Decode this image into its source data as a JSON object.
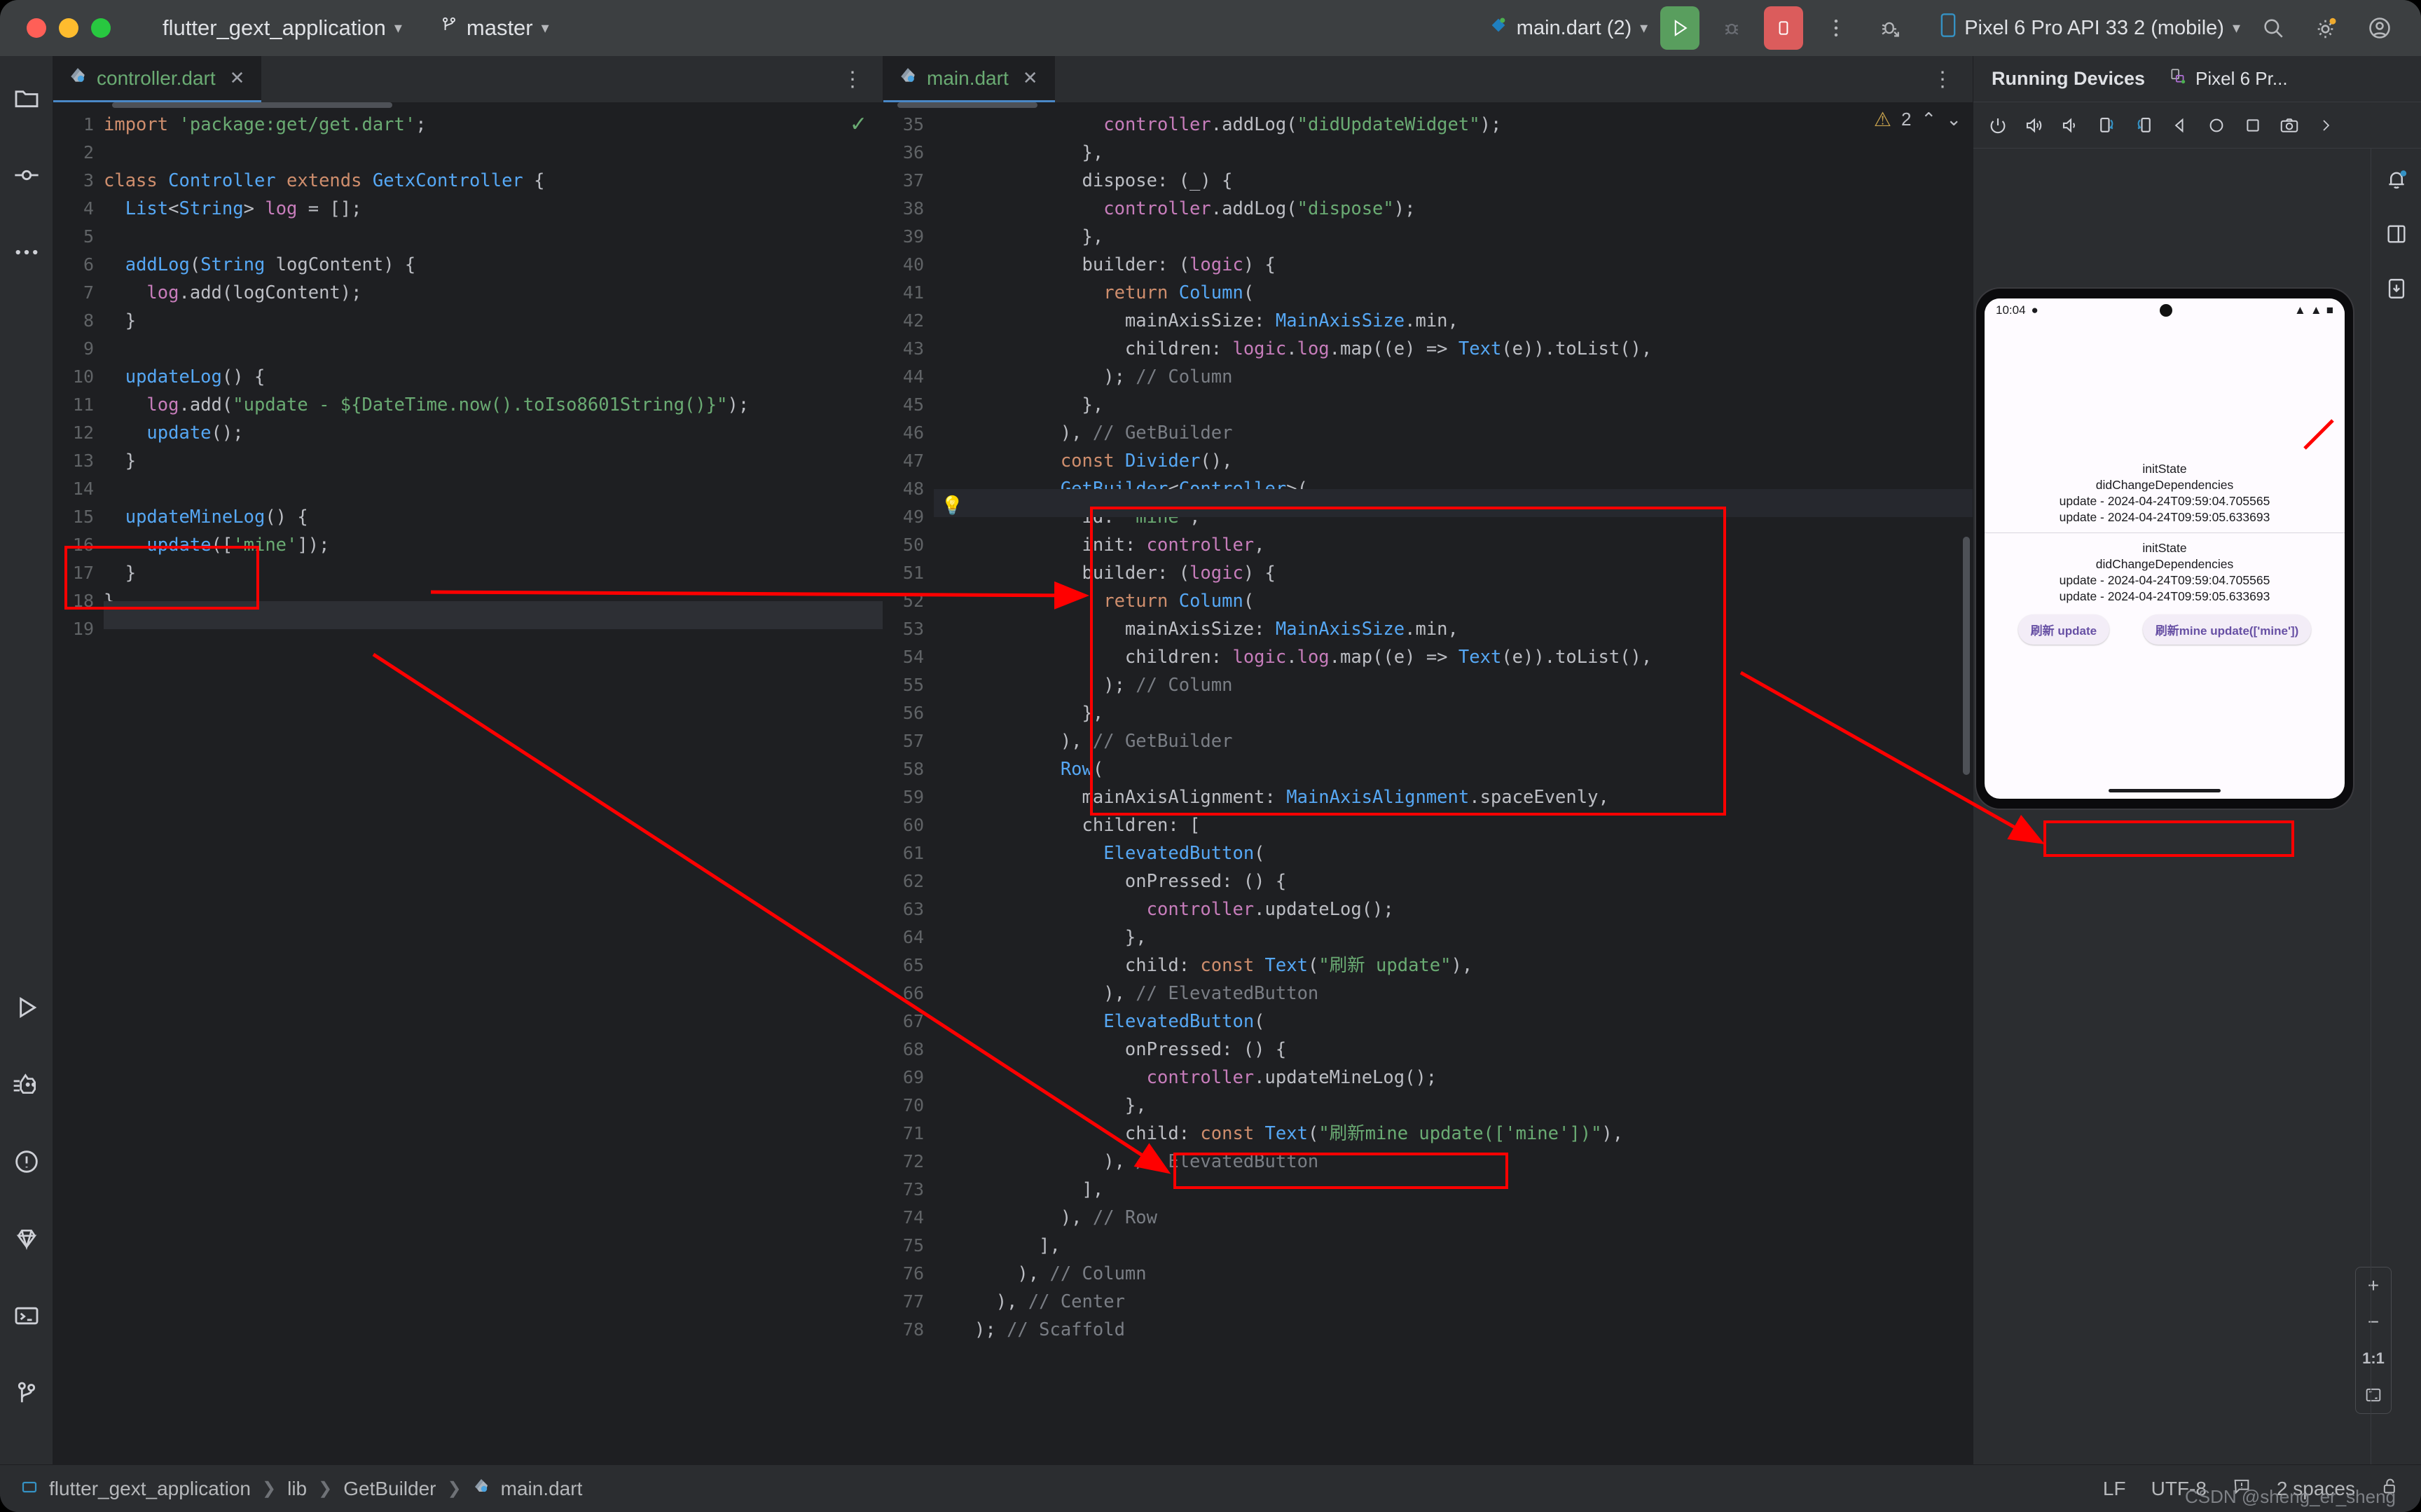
{
  "titlebar": {
    "project_name": "flutter_gext_application",
    "branch": "master",
    "run_config": "main.dart (2)",
    "device": "Pixel 6 Pro API 33 2 (mobile)",
    "icons": {
      "branch": "git-branch-icon",
      "run": "run-icon",
      "debug": "debug-icon",
      "stop": "stop-icon",
      "more": "more-vertical-icon",
      "profile": "profile-debug-icon",
      "search": "search-icon",
      "settings": "gear-icon",
      "account": "account-icon"
    }
  },
  "left_rail": {
    "top": [
      "project-icon",
      "commit-icon",
      "more-icon"
    ],
    "bottom": [
      "run-icon",
      "flutter-inspector-icon",
      "problems-icon",
      "pub-icon",
      "terminal-icon",
      "git-icon"
    ]
  },
  "editors": {
    "left": {
      "tab_label": "controller.dart",
      "first_line": 1,
      "analysis_ok": "✓",
      "lines": [
        "import 'package:get/get.dart';",
        "",
        "class Controller extends GetxController {",
        "  List<String> log = [];",
        "",
        "  addLog(String logContent) {",
        "    log.add(logContent);",
        "  }",
        "",
        "  updateLog() {",
        "    log.add(\"update - ${DateTime.now().toIso8601String()}\");",
        "    update();",
        "  }",
        "",
        "  updateMineLog() {",
        "    update(['mine']);",
        "  }",
        "}",
        ""
      ]
    },
    "right": {
      "tab_label": "main.dart",
      "first_line": 35,
      "warning_count": "2",
      "lines": [
        "            controller.addLog(\"didUpdateWidget\");",
        "          },",
        "          dispose: (_) {",
        "            controller.addLog(\"dispose\");",
        "          },",
        "          builder: (logic) {",
        "            return Column(",
        "              mainAxisSize: MainAxisSize.min,",
        "              children: logic.log.map((e) => Text(e)).toList(),",
        "            ); // Column",
        "          },",
        "        ), // GetBuilder",
        "        const Divider(),",
        "        GetBuilder<Controller>(",
        "          id: 'mine',",
        "          init: controller,",
        "          builder: (logic) {",
        "            return Column(",
        "              mainAxisSize: MainAxisSize.min,",
        "              children: logic.log.map((e) => Text(e)).toList(),",
        "            ); // Column",
        "          },",
        "        ), // GetBuilder",
        "        Row(",
        "          mainAxisAlignment: MainAxisAlignment.spaceEvenly,",
        "          children: [",
        "            ElevatedButton(",
        "              onPressed: () {",
        "                controller.updateLog();",
        "              },",
        "              child: const Text(\"刷新 update\"),",
        "            ), // ElevatedButton",
        "            ElevatedButton(",
        "              onPressed: () {",
        "                controller.updateMineLog();",
        "              },",
        "              child: const Text(\"刷新mine update(['mine'])\"),",
        "            ), // ElevatedButton",
        "          ],",
        "        ), // Row",
        "      ],",
        "    ), // Column",
        "  ), // Center",
        "); // Scaffold"
      ]
    }
  },
  "device_panel": {
    "title": "Running Devices",
    "tab_label": "Pixel 6 Pr...",
    "toolbar_icons": [
      "power-icon",
      "volume-up-icon",
      "volume-down-icon",
      "rotate-left-icon",
      "rotate-right-icon",
      "back-icon",
      "home-icon",
      "recents-icon",
      "screenshot-icon",
      "chevron-right-icon"
    ],
    "right_rail_icons": [
      "notifications-icon",
      "layout-icon",
      "device-manager-icon"
    ],
    "zoom": {
      "in": "+",
      "out": "−",
      "actual": "1:1",
      "fit": "fit-screen-icon"
    },
    "emulator": {
      "status_time": "10:04",
      "logs_group_1": [
        "initState",
        "didChangeDependencies",
        "update - 2024-04-24T09:59:04.705565",
        "update - 2024-04-24T09:59:05.633693"
      ],
      "logs_group_2": [
        "initState",
        "didChangeDependencies",
        "update - 2024-04-24T09:59:04.705565",
        "update - 2024-04-24T09:59:05.633693"
      ],
      "buttons": [
        "刷新 update",
        "刷新mine update(['mine'])"
      ]
    }
  },
  "status_bar": {
    "breadcrumb": [
      "flutter_gext_application",
      "lib",
      "GetBuilder",
      "main.dart"
    ],
    "line_ending": "LF",
    "encoding": "UTF-8",
    "indent": "2 spaces",
    "inspection_icon": "inspections-icon",
    "lock_icon": "lock-icon",
    "watermark": "CSDN @sheng_er_sheng"
  },
  "annotations": {
    "color": "#ff0000",
    "boxes": [
      "left-updateMineLog-method",
      "right-getbuilder-mine-block",
      "right-updateMineLog-call",
      "emulator-update-logs"
    ],
    "arrows": [
      "left-method-to-getbuilder",
      "left-method-to-call",
      "getbuilder-to-emulator-logs"
    ]
  }
}
